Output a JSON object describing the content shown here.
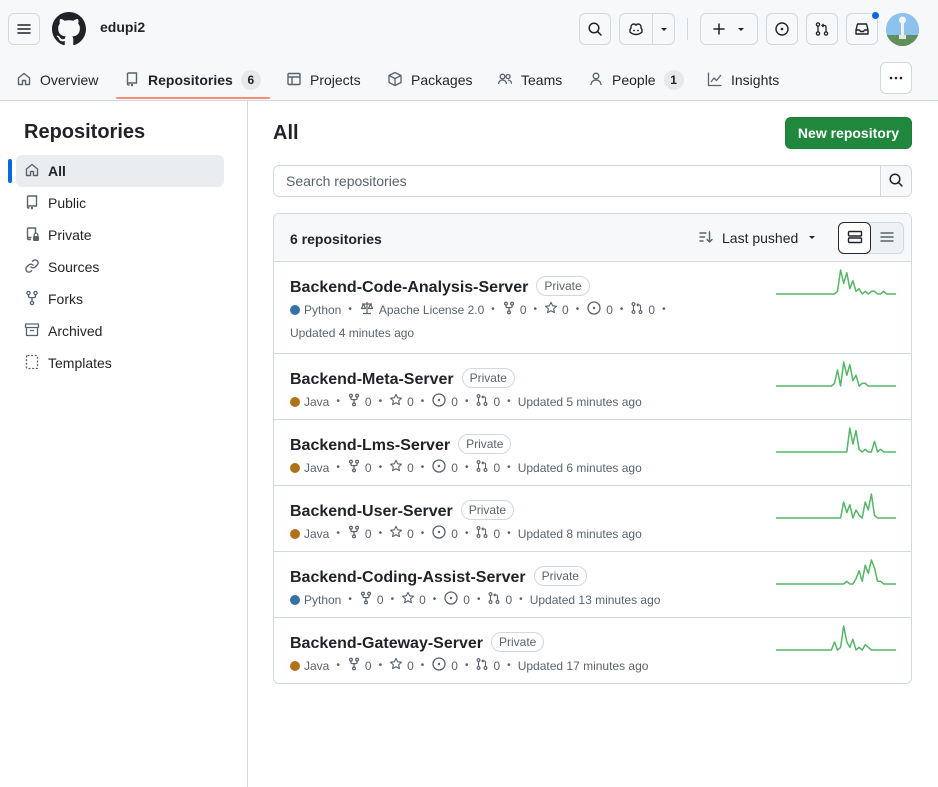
{
  "header": {
    "org_name": "edupi2"
  },
  "nav": {
    "tabs": [
      {
        "label": "Overview"
      },
      {
        "label": "Repositories",
        "count": "6"
      },
      {
        "label": "Projects"
      },
      {
        "label": "Packages"
      },
      {
        "label": "Teams"
      },
      {
        "label": "People",
        "count": "1"
      },
      {
        "label": "Insights"
      }
    ]
  },
  "sidebar": {
    "title": "Repositories",
    "items": [
      {
        "label": "All",
        "icon": "home-icon",
        "active": true
      },
      {
        "label": "Public",
        "icon": "repo-icon"
      },
      {
        "label": "Private",
        "icon": "lock-repo-icon"
      },
      {
        "label": "Sources",
        "icon": "link-icon"
      },
      {
        "label": "Forks",
        "icon": "fork-icon"
      },
      {
        "label": "Archived",
        "icon": "archive-icon"
      },
      {
        "label": "Templates",
        "icon": "template-icon"
      }
    ]
  },
  "main": {
    "title": "All",
    "new_repo_label": "New repository",
    "search_placeholder": "Search repositories",
    "count_label": "6 repositories",
    "sort_label": "Last pushed"
  },
  "colors": {
    "python": "#3572a5",
    "java": "#b07219",
    "spark": "#56b568",
    "primary_button": "#1f883d"
  },
  "repos": [
    {
      "name": "Backend-Code-Analysis-Server",
      "visibility": "Private",
      "language": "Python",
      "lang_color": "#3572a5",
      "license": "Apache License 2.0",
      "forks": "0",
      "stars": "0",
      "issues": "0",
      "prs": "0",
      "updated": "Updated 4 minutes ago",
      "activity": [
        0,
        0,
        0,
        0,
        0,
        0,
        0,
        0,
        0,
        0,
        0,
        0,
        0,
        0,
        0,
        0,
        0,
        0,
        0,
        0,
        1,
        9,
        4,
        8,
        2,
        5,
        1,
        2,
        0,
        1,
        0,
        1,
        1,
        0,
        0,
        1,
        0,
        0,
        0,
        0
      ]
    },
    {
      "name": "Backend-Meta-Server",
      "visibility": "Private",
      "language": "Java",
      "lang_color": "#b07219",
      "forks": "0",
      "stars": "0",
      "issues": "0",
      "prs": "0",
      "updated": "Updated 5 minutes ago",
      "activity": [
        0,
        0,
        0,
        0,
        0,
        0,
        0,
        0,
        0,
        0,
        0,
        0,
        0,
        0,
        0,
        0,
        0,
        0,
        0,
        1,
        6,
        0,
        9,
        4,
        8,
        2,
        4,
        0,
        1,
        1,
        0,
        0,
        0,
        0,
        0,
        0,
        0,
        0,
        0,
        0
      ]
    },
    {
      "name": "Backend-Lms-Server",
      "visibility": "Private",
      "language": "Java",
      "lang_color": "#b07219",
      "forks": "0",
      "stars": "0",
      "issues": "0",
      "prs": "0",
      "updated": "Updated 6 minutes ago",
      "activity": [
        0,
        0,
        0,
        0,
        0,
        0,
        0,
        0,
        0,
        0,
        0,
        0,
        0,
        0,
        0,
        0,
        0,
        0,
        0,
        0,
        0,
        0,
        0,
        0,
        9,
        3,
        8,
        1,
        0,
        1,
        0,
        0,
        4,
        0,
        1,
        0,
        0,
        0,
        0,
        0
      ]
    },
    {
      "name": "Backend-User-Server",
      "visibility": "Private",
      "language": "Java",
      "lang_color": "#b07219",
      "forks": "0",
      "stars": "0",
      "issues": "0",
      "prs": "0",
      "updated": "Updated 8 minutes ago",
      "activity": [
        0,
        0,
        0,
        0,
        0,
        0,
        0,
        0,
        0,
        0,
        0,
        0,
        0,
        0,
        0,
        0,
        0,
        0,
        0,
        0,
        0,
        0,
        6,
        2,
        5,
        0,
        3,
        1,
        0,
        6,
        3,
        9,
        1,
        0,
        0,
        0,
        0,
        0,
        0,
        0
      ]
    },
    {
      "name": "Backend-Coding-Assist-Server",
      "visibility": "Private",
      "language": "Python",
      "lang_color": "#3572a5",
      "forks": "0",
      "stars": "0",
      "issues": "0",
      "prs": "0",
      "updated": "Updated 13 minutes ago",
      "activity": [
        0,
        0,
        0,
        0,
        0,
        0,
        0,
        0,
        0,
        0,
        0,
        0,
        0,
        0,
        0,
        0,
        0,
        0,
        0,
        0,
        0,
        0,
        0,
        1,
        0,
        0,
        2,
        5,
        1,
        7,
        4,
        9,
        6,
        1,
        1,
        0,
        0,
        0,
        0,
        0
      ]
    },
    {
      "name": "Backend-Gateway-Server",
      "visibility": "Private",
      "language": "Java",
      "lang_color": "#b07219",
      "forks": "0",
      "stars": "0",
      "issues": "0",
      "prs": "0",
      "updated": "Updated 17 minutes ago",
      "activity": [
        0,
        0,
        0,
        0,
        0,
        0,
        0,
        0,
        0,
        0,
        0,
        0,
        0,
        0,
        0,
        0,
        0,
        0,
        0,
        3,
        0,
        1,
        9,
        3,
        1,
        4,
        0,
        1,
        0,
        2,
        1,
        0,
        0,
        0,
        0,
        0,
        0,
        0,
        0,
        0
      ]
    }
  ]
}
